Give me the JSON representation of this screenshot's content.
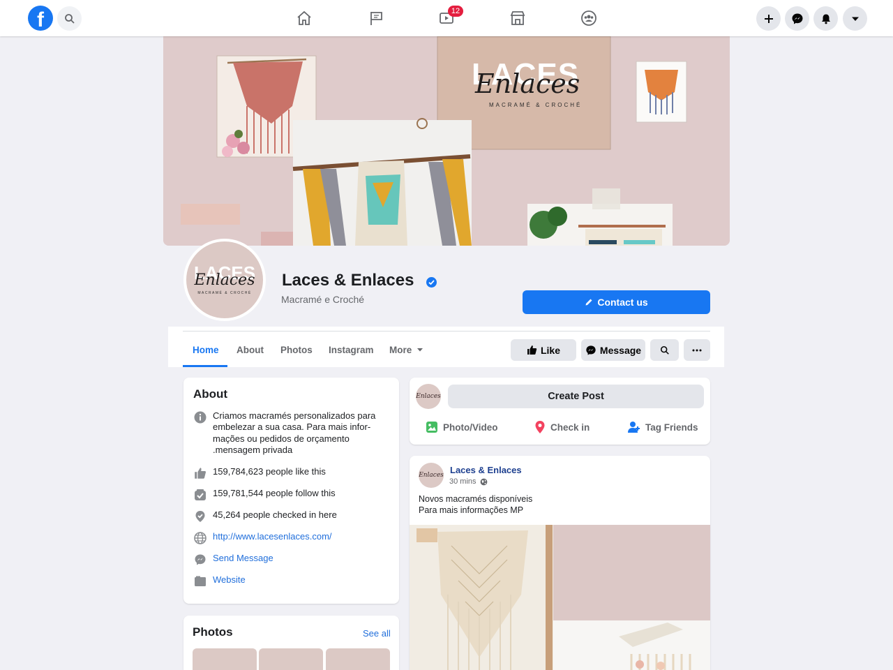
{
  "topbar": {
    "logo_letter": "f",
    "notifications_badge": "12",
    "icons": [
      "facebook-logo",
      "search-icon",
      "home-icon",
      "pages-flag-icon",
      "watch-icon",
      "marketplace-icon",
      "groups-icon",
      "plus-icon",
      "messenger-icon",
      "bell-icon",
      "caret-down-icon"
    ]
  },
  "cover": {
    "brand_top": "LACES",
    "brand_script": "Enlaces",
    "brand_tagline": "MACRAMÉ & CROCHÉ"
  },
  "profile": {
    "avatar_top": "LACES",
    "avatar_script": "Enlaces",
    "avatar_tagline": "MACRAMÉ & CROCHÉ",
    "name": "Laces & Enlaces",
    "category": "Macramé e Croché",
    "contact_label": "Contact us"
  },
  "tabs": {
    "home": "Home",
    "about": "About",
    "photos": "Photos",
    "instagram": "Instagram",
    "more": "More",
    "like": "Like",
    "message": "Message"
  },
  "about": {
    "title": "About",
    "description": "Criamos macramés personalizados para embelezar a sua casa. Para mais infor-mações ou pedidos de orçamento .mensagem privada",
    "likes": "159,784,623 people like this",
    "follows": "159,781,544 people follow this",
    "checkins": "45,264 people checked in here",
    "website_url": "http://www.lacesenlaces.com/",
    "send_message": "Send Message",
    "website_label": "Website"
  },
  "photos_card": {
    "title": "Photos",
    "see_all": "See all"
  },
  "composer": {
    "avatar_text": "Enlaces",
    "create_post": "Create Post",
    "photo_video": "Photo/Video",
    "check_in": "Check in",
    "tag_friends": "Tag Friends"
  },
  "post": {
    "avatar_text": "Enlaces",
    "author": "Laces & Enlaces",
    "time": "30 mins",
    "line1": "Novos macramés disponíveis",
    "line2": "Para mais informações MP"
  },
  "colors": {
    "accent": "#1877f2",
    "cover_pink": "#dfcbcb",
    "badge_red": "#e41e3f"
  }
}
